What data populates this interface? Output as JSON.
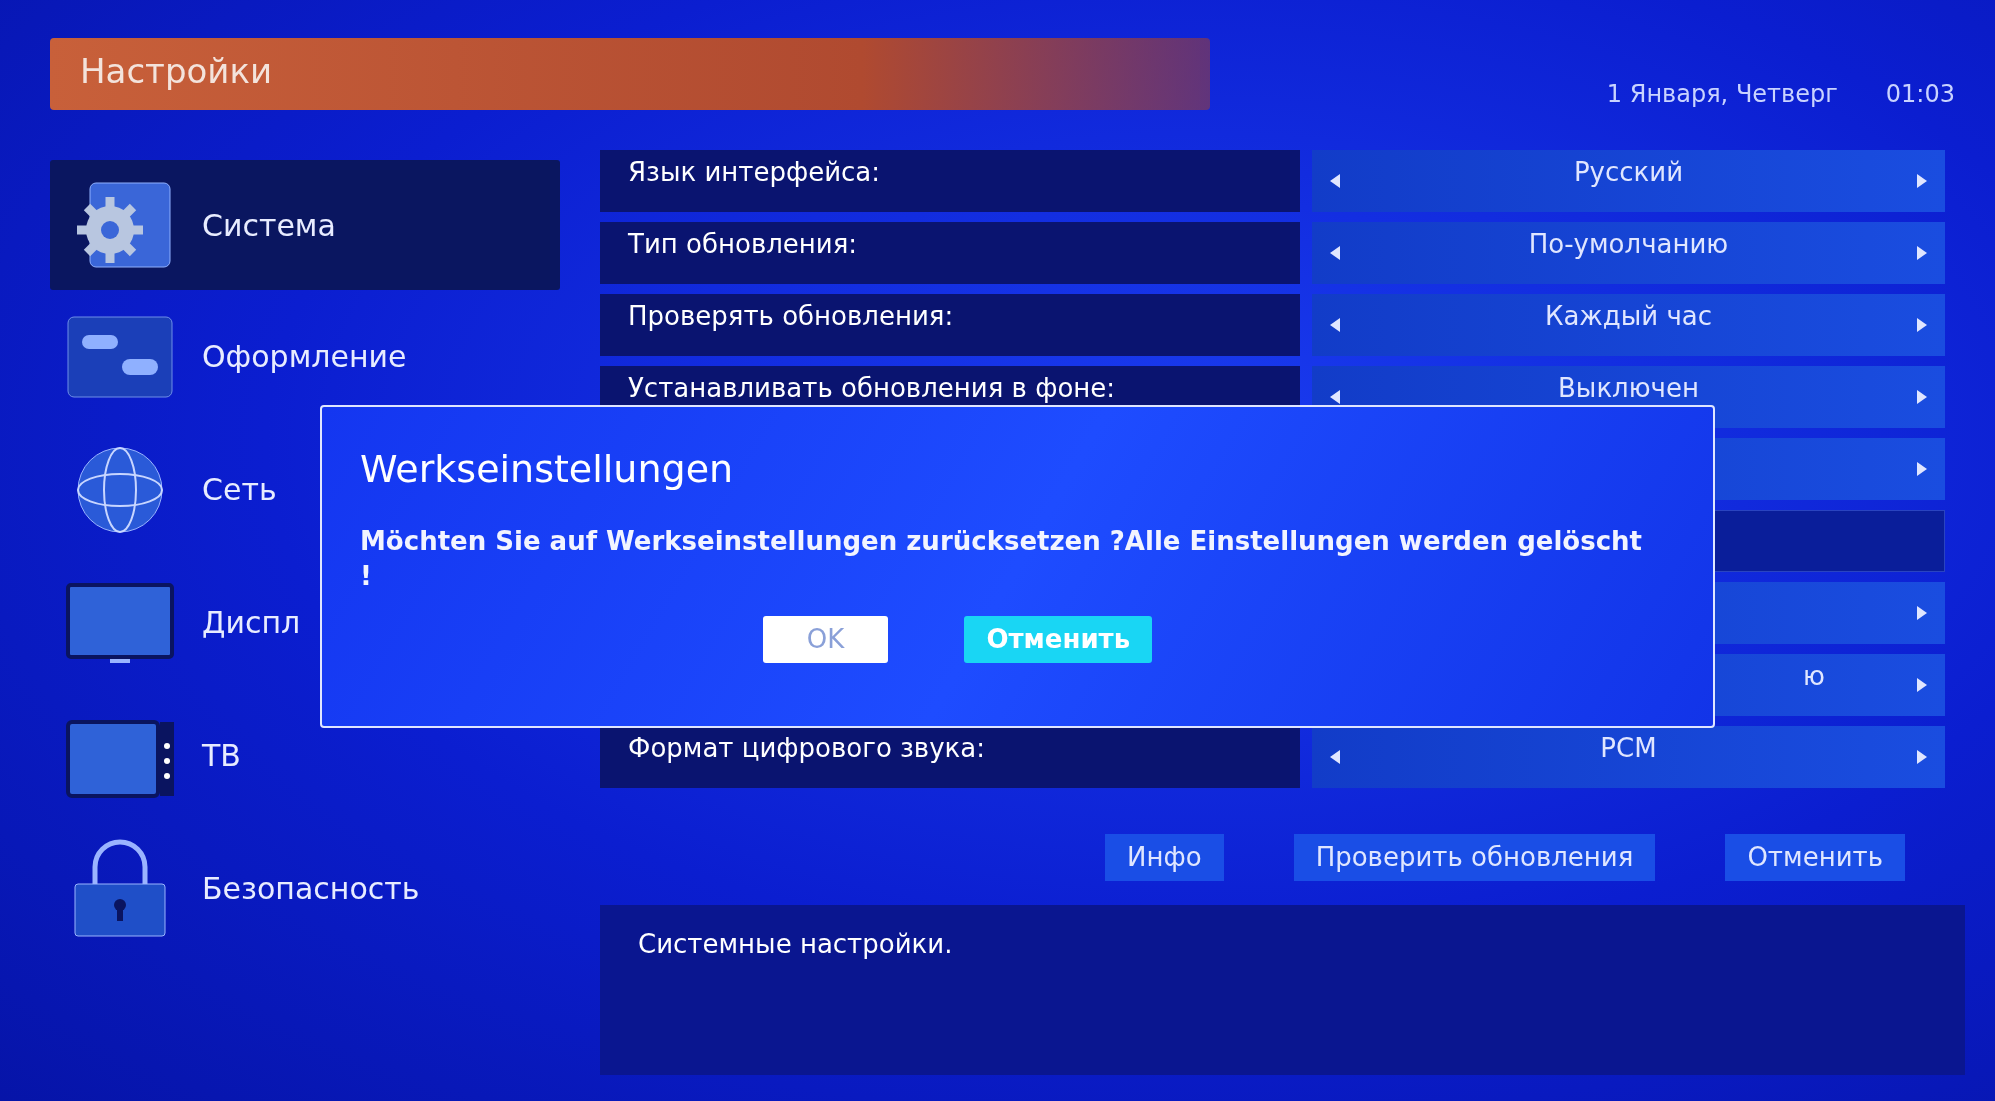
{
  "header": {
    "title": "Настройки",
    "date": "1 Января, Четверг",
    "time": "01:03"
  },
  "sidebar": {
    "items": [
      {
        "label": "Система",
        "selected": true
      },
      {
        "label": "Оформление",
        "selected": false
      },
      {
        "label": "Сеть",
        "selected": false
      },
      {
        "label": "Диспл",
        "selected": false
      },
      {
        "label": "ТВ",
        "selected": false
      },
      {
        "label": "Безопасность",
        "selected": false
      }
    ]
  },
  "settings": [
    {
      "kind": "select",
      "label": "Язык интерфейса:",
      "value": "Русский"
    },
    {
      "kind": "select",
      "label": "Тип обновления:",
      "value": "По-умолчанию"
    },
    {
      "kind": "select",
      "label": "Проверять обновления:",
      "value": "Каждый час"
    },
    {
      "kind": "select",
      "label": "Устанавливать обновления в фоне:",
      "value": "Выключен"
    },
    {
      "kind": "covered"
    },
    {
      "kind": "text"
    },
    {
      "kind": "covered"
    },
    {
      "kind": "clipped",
      "value": "ю"
    },
    {
      "kind": "select",
      "label": "Формат цифрового звука:",
      "value": "PCM"
    }
  ],
  "actions": [
    {
      "label": "Инфо"
    },
    {
      "label": "Проверить обновления"
    },
    {
      "label": "Отменить"
    }
  ],
  "info": "Системные настройки.",
  "dialog": {
    "title": "Werkseinstellungen",
    "message": "Möchten Sie auf Werkseinstellungen zurücksetzen ?Alle Einstellungen werden gelöscht !",
    "buttons": [
      {
        "label": "OK",
        "selected": false
      },
      {
        "label": "Отменить",
        "selected": true
      }
    ]
  }
}
